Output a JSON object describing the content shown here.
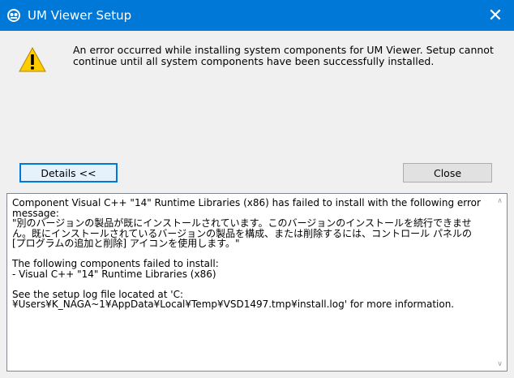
{
  "window": {
    "title": "UM Viewer Setup",
    "close_glyph": "✕"
  },
  "message": {
    "text": "An error occurred while installing system components for UM Viewer. Setup cannot continue until all system components have been successfully installed."
  },
  "buttons": {
    "details_label": "Details <<",
    "close_label": "Close"
  },
  "details": {
    "text": "Component Visual C++ \"14\" Runtime Libraries (x86) has failed to install with the following error message:\n\"別のバージョンの製品が既にインストールされています。このバージョンのインストールを続行できません。既にインストールされているバージョンの製品を構成、または削除するには、コントロール パネルの [プログラムの追加と削除] アイコンを使用します。\"\n\nThe following components failed to install:\n- Visual C++ \"14\" Runtime Libraries (x86)\n\nSee the setup log file located at 'C:¥Users¥K_NAGA~1¥AppData¥Local¥Temp¥VSD1497.tmp¥install.log' for more information.",
    "scroll_up_glyph": "∧",
    "scroll_down_glyph": "∨"
  },
  "icons": {
    "app": "setup-app-icon",
    "warning": "warning-icon"
  },
  "colors": {
    "titlebar": "#0078d7",
    "warning_fill": "#ffcc00"
  }
}
